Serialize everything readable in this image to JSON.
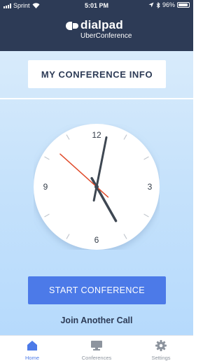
{
  "status_bar": {
    "carrier": "Sprint",
    "time": "5:01 PM",
    "battery": "96%",
    "battery_level": 0.96
  },
  "brand": {
    "name": "dialpad",
    "subtitle": "UberConference"
  },
  "main": {
    "info_button": "MY CONFERENCE INFO",
    "start_button": "START CONFERENCE",
    "join_link": "Join Another Call"
  },
  "clock": {
    "labels": {
      "top": "12",
      "right": "3",
      "bottom": "6",
      "left": "9"
    },
    "hours": 5,
    "minutes": 1,
    "seconds": 52,
    "second_hand_color": "#e04a2a"
  },
  "tabs": [
    {
      "label": "Home",
      "icon": "home-icon",
      "active": true
    },
    {
      "label": "Conferences",
      "icon": "monitor-icon",
      "active": false
    },
    {
      "label": "Settings",
      "icon": "gear-icon",
      "active": false
    }
  ],
  "colors": {
    "header": "#2d3b56",
    "accent": "#4c7ae8",
    "inactive_tab": "#8d949e"
  }
}
